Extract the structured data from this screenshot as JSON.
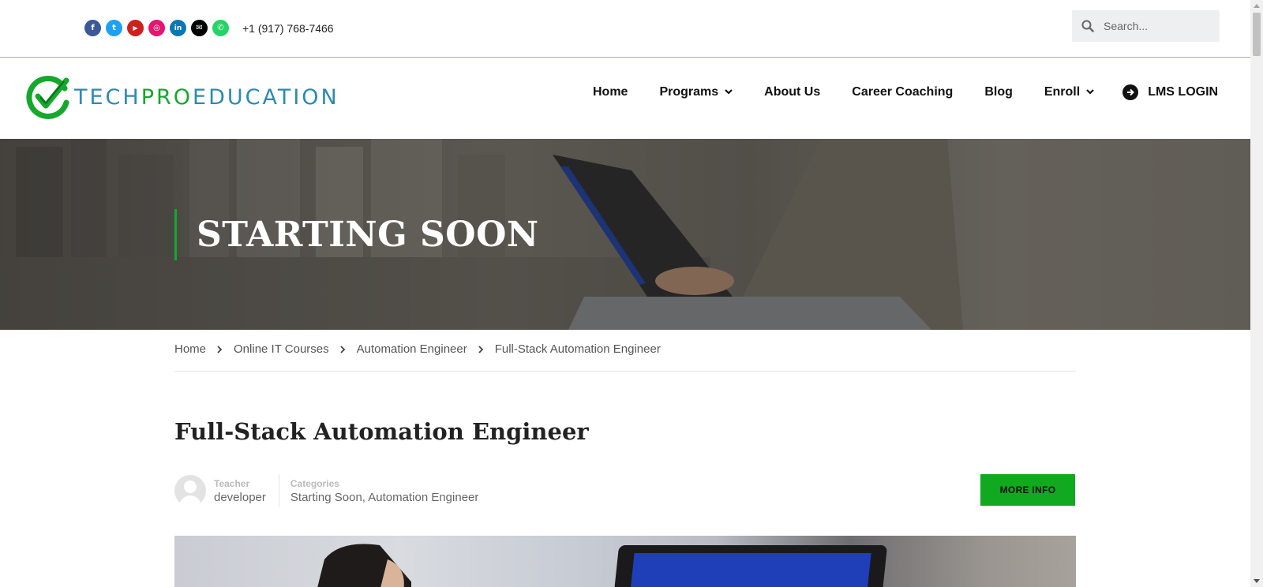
{
  "topbar": {
    "social_icons": [
      {
        "name": "facebook-icon",
        "glyph": "f",
        "color": "#3b5998"
      },
      {
        "name": "twitter-icon",
        "glyph": "t",
        "color": "#1da1f2"
      },
      {
        "name": "youtube-icon",
        "glyph": "▶",
        "color": "#cd201f"
      },
      {
        "name": "instagram-icon",
        "glyph": "◎",
        "color": "#e4166f"
      },
      {
        "name": "linkedin-icon",
        "glyph": "in",
        "color": "#0a77b5"
      },
      {
        "name": "email-icon",
        "glyph": "✉",
        "color": "#000000"
      },
      {
        "name": "whatsapp-icon",
        "glyph": "✆",
        "color": "#25d366"
      }
    ],
    "phone": "+1 (917) 768-7466",
    "search_placeholder": "Search..."
  },
  "header": {
    "logo_part1": "TECH",
    "logo_part2": "PRO",
    "logo_part3": "EDUCATION",
    "nav": {
      "home": "Home",
      "programs": "Programs",
      "about": "About Us",
      "coaching": "Career Coaching",
      "blog": "Blog",
      "enroll": "Enroll",
      "lms": "LMS LOGIN"
    }
  },
  "hero": {
    "title": "STARTING SOON"
  },
  "breadcrumbs": {
    "home": "Home",
    "courses": "Online IT Courses",
    "category": "Automation Engineer",
    "current": "Full-Stack Automation Engineer"
  },
  "course": {
    "title": "Full-Stack Automation Engineer",
    "teacher_label": "Teacher",
    "teacher_name": "developer",
    "categories_label": "Categories",
    "categories_value": "Starting Soon, Automation Engineer",
    "more_info": "MORE INFO"
  },
  "colors": {
    "accent_green": "#10a91f",
    "logo_blue": "#2a8bb3",
    "logo_green": "#14a82c"
  }
}
